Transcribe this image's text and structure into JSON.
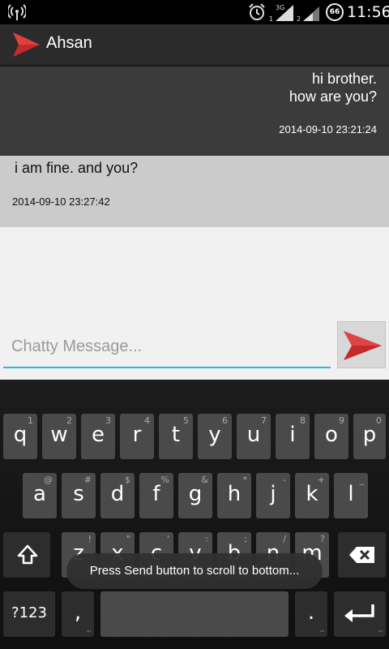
{
  "status_bar": {
    "network_3g": "3G",
    "sim1": "1",
    "sim2": "2",
    "battery": "66",
    "time": "11:56",
    "icons": [
      "wifi-icon",
      "alarm-icon",
      "signal-icon",
      "battery-icon"
    ]
  },
  "action_bar": {
    "title": "Ahsan",
    "logo_icon": "paper-plane-icon"
  },
  "messages": [
    {
      "direction": "outgoing",
      "text": "hi brother.\nhow are you?",
      "time": "2014-09-10 23:21:24"
    },
    {
      "direction": "incoming",
      "text": "i am fine. and you?",
      "time": "2014-09-10 23:27:42"
    }
  ],
  "composer": {
    "placeholder": "Chatty Message...",
    "value": "",
    "send_icon": "send-icon"
  },
  "keyboard": {
    "row1": [
      {
        "ch": "q",
        "hint": "1"
      },
      {
        "ch": "w",
        "hint": "2"
      },
      {
        "ch": "e",
        "hint": "3"
      },
      {
        "ch": "r",
        "hint": "4"
      },
      {
        "ch": "t",
        "hint": "5"
      },
      {
        "ch": "y",
        "hint": "6"
      },
      {
        "ch": "u",
        "hint": "7"
      },
      {
        "ch": "i",
        "hint": "8"
      },
      {
        "ch": "o",
        "hint": "9"
      },
      {
        "ch": "p",
        "hint": "0"
      }
    ],
    "row2": [
      {
        "ch": "a",
        "hint": "@"
      },
      {
        "ch": "s",
        "hint": "#"
      },
      {
        "ch": "d",
        "hint": "$"
      },
      {
        "ch": "f",
        "hint": "%"
      },
      {
        "ch": "g",
        "hint": "&"
      },
      {
        "ch": "h",
        "hint": "*"
      },
      {
        "ch": "j",
        "hint": "-"
      },
      {
        "ch": "k",
        "hint": "+"
      },
      {
        "ch": "l",
        "hint": "_"
      }
    ],
    "row3": [
      {
        "ch": "z",
        "hint": "!"
      },
      {
        "ch": "x",
        "hint": "\""
      },
      {
        "ch": "c",
        "hint": "'"
      },
      {
        "ch": "v",
        "hint": ":"
      },
      {
        "ch": "b",
        "hint": ";"
      },
      {
        "ch": "n",
        "hint": "/"
      },
      {
        "ch": "m",
        "hint": "?"
      }
    ],
    "symbols_label": "?123",
    "comma": ",",
    "period": ".",
    "shift_icon": "shift-icon",
    "backspace_icon": "backspace-icon",
    "enter_icon": "enter-icon"
  },
  "toast": "Press Send button to scroll to bottom..."
}
